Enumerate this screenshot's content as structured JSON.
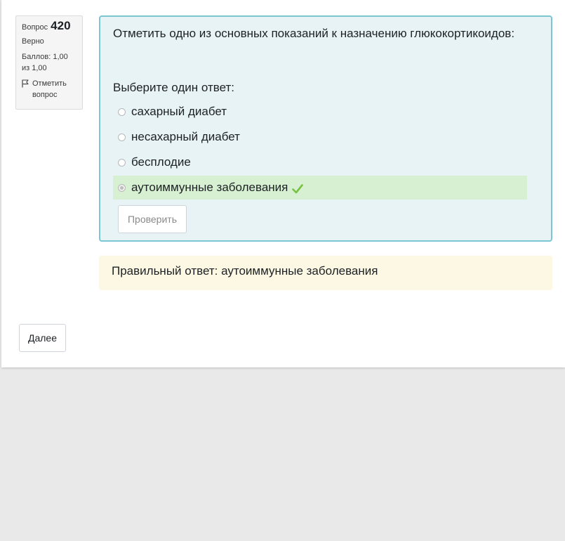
{
  "info": {
    "question_label": "Вопрос",
    "question_number": "420",
    "state": "Верно",
    "grade": "Баллов: 1,00 из 1,00",
    "flag_label": "Отметить вопрос",
    "flag_icon": "flag-icon"
  },
  "question": {
    "text": "Отметить одно из основных показаний к назначению глюкокортикоидов:",
    "prompt": "Выберите один ответ:",
    "options": [
      {
        "label": "сахарный диабет",
        "selected": false,
        "correct": false
      },
      {
        "label": "несахарный диабет",
        "selected": false,
        "correct": false
      },
      {
        "label": "бесплодие",
        "selected": false,
        "correct": false
      },
      {
        "label": "аутоиммунные заболевания",
        "selected": true,
        "correct": true
      }
    ],
    "correct_icon": "check-icon",
    "check_button": "Проверить"
  },
  "feedback": {
    "right_answer": "Правильный ответ: аутоиммунные заболевания"
  },
  "navigation": {
    "next_button": "Далее"
  },
  "colors": {
    "formulation_bg": "#e7f3f5",
    "formulation_border": "#7bc6d2",
    "correct_bg": "#d7f0d1",
    "check_green": "#7ac143",
    "feedback_bg": "#fcf8e3"
  }
}
